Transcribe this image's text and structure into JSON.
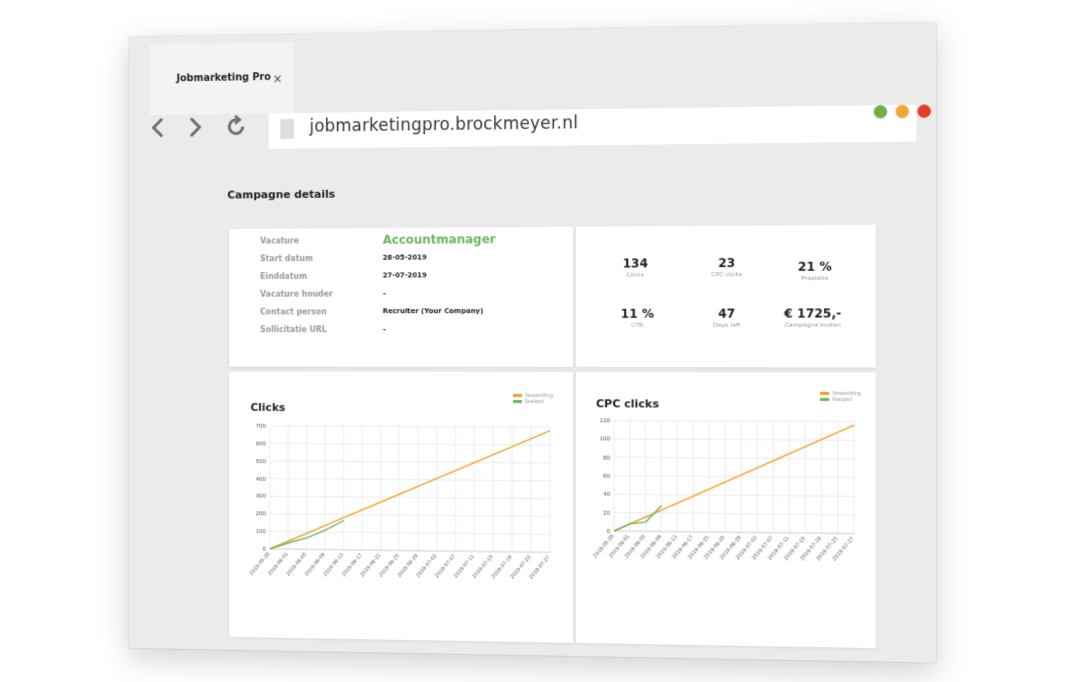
{
  "browser": {
    "tab_title": "Jobmarketing Pro",
    "tab_close": "×",
    "url": "jobmarketingpro.brockmeyer.nl",
    "back_icon": "chevron-left-icon",
    "forward_icon": "chevron-right-icon",
    "reload_icon": "reload-icon",
    "traffic_colors": [
      "#6ab04c",
      "#f0a830",
      "#e63c2c"
    ]
  },
  "page": {
    "title": "Campagne details"
  },
  "details": {
    "labels": [
      "Vacature",
      "Start datum",
      "Einddatum",
      "Vacature houder",
      "Contact person",
      "Sollicitatie URL"
    ],
    "vacature": "Accountmanager",
    "start_datum": "28-05-2019",
    "einddatum": "27-07-2019",
    "vacature_houder": "–",
    "contact_person": "Recruiter (Your Company)",
    "sollicitatie_url": "–"
  },
  "stats": [
    {
      "value": "134",
      "label": "Clicks"
    },
    {
      "value": "23",
      "label": "CPC clicks"
    },
    {
      "value": "21 %",
      "label": "Prestatie"
    },
    {
      "value": "11 %",
      "label": "CTR"
    },
    {
      "value": "47",
      "label": "Days left"
    },
    {
      "value": "€ 1725,-",
      "label": "Campagne kosten"
    }
  ],
  "colors": {
    "expected": "#f0a030",
    "realized": "#6db560",
    "accent": "#6db560"
  },
  "chart_data": [
    {
      "type": "line",
      "title": "Clicks",
      "ylim": [
        0,
        700
      ],
      "yticks": [
        0,
        100,
        200,
        300,
        400,
        500,
        600,
        700
      ],
      "x": [
        "2019-05-28",
        "2019-06-01",
        "2019-06-05",
        "2019-06-09",
        "2019-06-13",
        "2019-06-17",
        "2019-06-21",
        "2019-06-25",
        "2019-06-29",
        "2019-07-03",
        "2019-07-07",
        "2019-07-11",
        "2019-07-15",
        "2019-07-19",
        "2019-07-23",
        "2019-07-27"
      ],
      "legend": [
        "Verwachting",
        "Realized"
      ],
      "series": [
        {
          "name": "Verwachting",
          "x_index": [
            0,
            15
          ],
          "values": [
            0,
            680
          ]
        },
        {
          "name": "Realized",
          "x_index": [
            0,
            1,
            2,
            3,
            4
          ],
          "values": [
            0,
            35,
            65,
            110,
            165
          ]
        }
      ],
      "grid": true
    },
    {
      "type": "line",
      "title": "CPC clicks",
      "ylim": [
        0,
        120
      ],
      "yticks": [
        0,
        20,
        40,
        60,
        80,
        100,
        120
      ],
      "x": [
        "2019-05-28",
        "2019-06-01",
        "2019-06-05",
        "2019-06-09",
        "2019-06-13",
        "2019-06-17",
        "2019-06-21",
        "2019-06-25",
        "2019-06-29",
        "2019-07-03",
        "2019-07-07",
        "2019-07-11",
        "2019-07-15",
        "2019-07-19",
        "2019-07-23",
        "2019-07-27"
      ],
      "legend": [
        "Verwachting",
        "Realized"
      ],
      "series": [
        {
          "name": "Verwachting",
          "x_index": [
            0,
            15
          ],
          "values": [
            0,
            116
          ]
        },
        {
          "name": "Realized",
          "x_index": [
            0,
            1,
            2,
            3
          ],
          "values": [
            0,
            8,
            10,
            28
          ]
        }
      ],
      "grid": true
    }
  ]
}
